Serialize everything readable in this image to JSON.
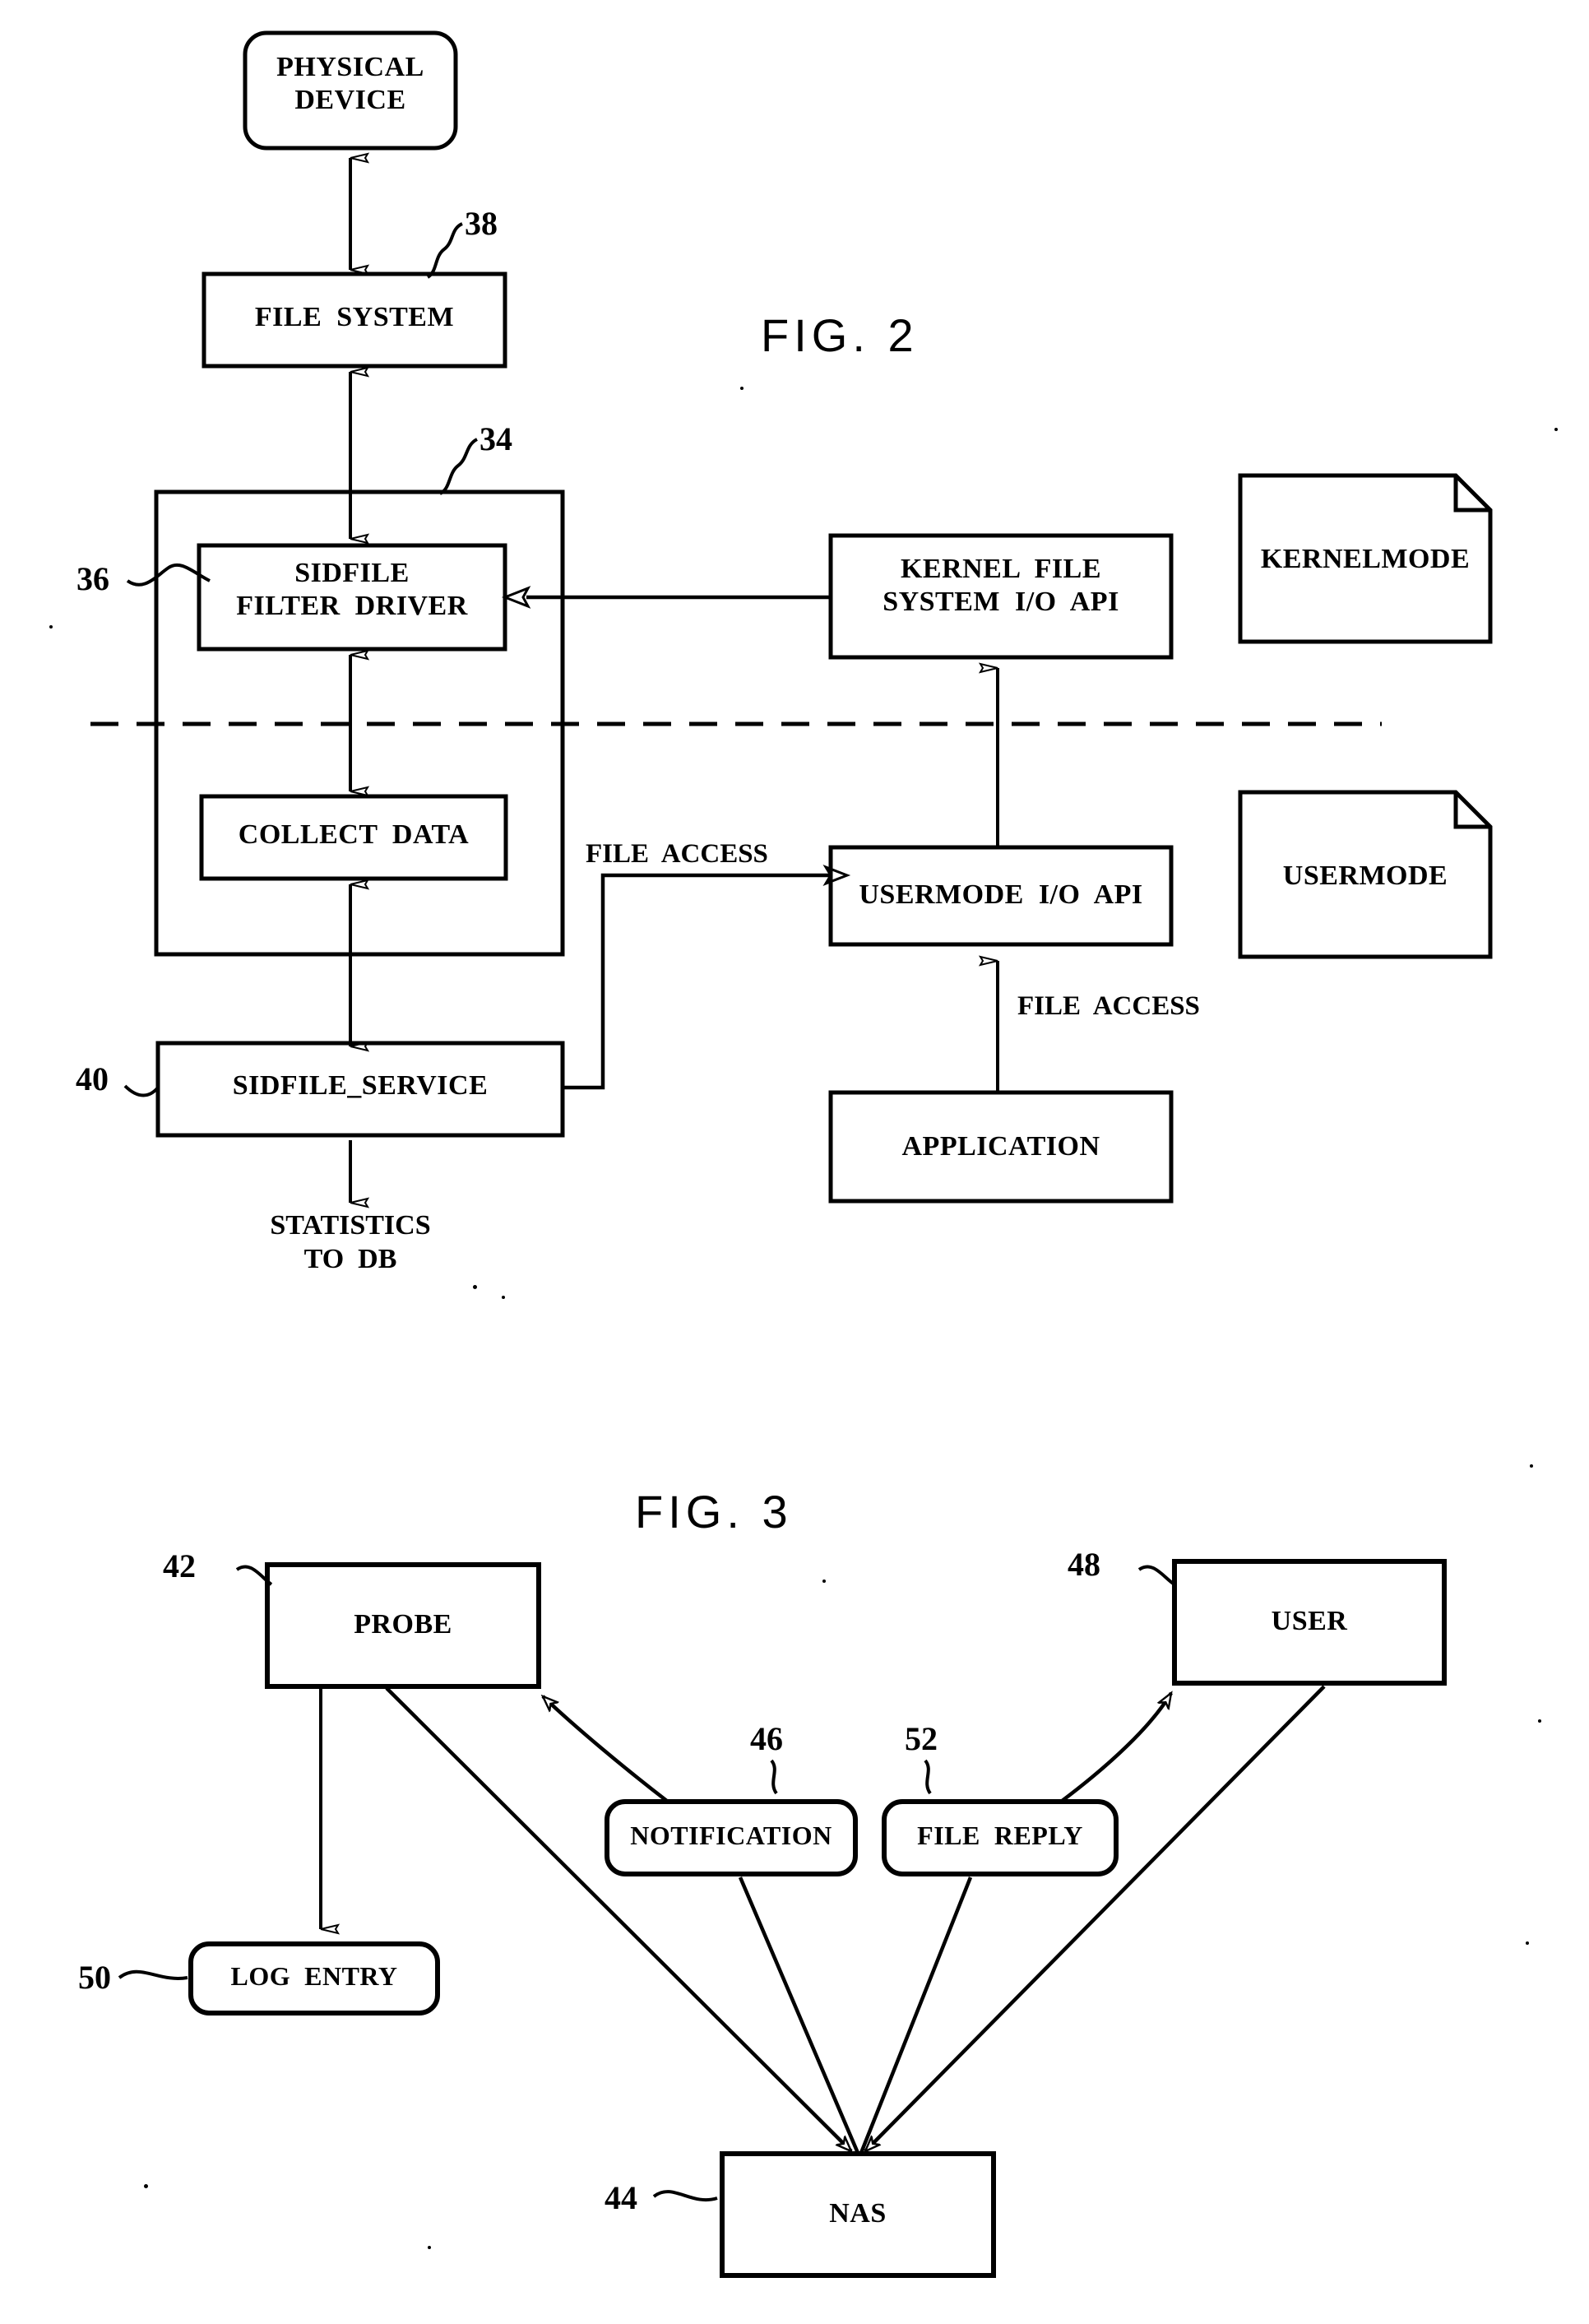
{
  "document": {
    "type": "patent-figure-sheet",
    "figures": [
      "FIG. 2",
      "FIG. 3"
    ]
  },
  "fig2": {
    "title": "FIG.  2",
    "boxes": {
      "physical_device": "PHYSICAL\nDEVICE",
      "file_system": "FILE  SYSTEM",
      "sidfile_filter_driver": "SIDFILE\nFILTER  DRIVER",
      "collect_data": "COLLECT  DATA",
      "sidfile_service": "SIDFILE_SERVICE",
      "kernel_file_system_io_api": "KERNEL  FILE\nSYSTEM  I/O  API",
      "usermode_io_api": "USERMODE  I/O  API",
      "application": "APPLICATION"
    },
    "notes": {
      "kernelmode": "KERNELMODE",
      "usermode": "USERMODE"
    },
    "edge_labels": {
      "file_access_left": "FILE  ACCESS",
      "file_access_right": "FILE  ACCESS"
    },
    "terminal_labels": {
      "statistics_to_db": "STATISTICS\nTO  DB"
    },
    "reference_numerals": {
      "file_system": "38",
      "container": "34",
      "filter_driver": "36",
      "sidfile_service": "40"
    }
  },
  "fig3": {
    "title": "FIG.  3",
    "boxes": {
      "probe": "PROBE",
      "user": "USER",
      "notification": "NOTIFICATION",
      "file_reply": "FILE  REPLY",
      "log_entry": "LOG  ENTRY",
      "nas": "NAS"
    },
    "reference_numerals": {
      "probe": "42",
      "nas": "44",
      "notification": "46",
      "user": "48",
      "log_entry": "50",
      "file_reply": "52"
    }
  },
  "colors": {
    "ink": "#000000",
    "paper": "#ffffff"
  }
}
